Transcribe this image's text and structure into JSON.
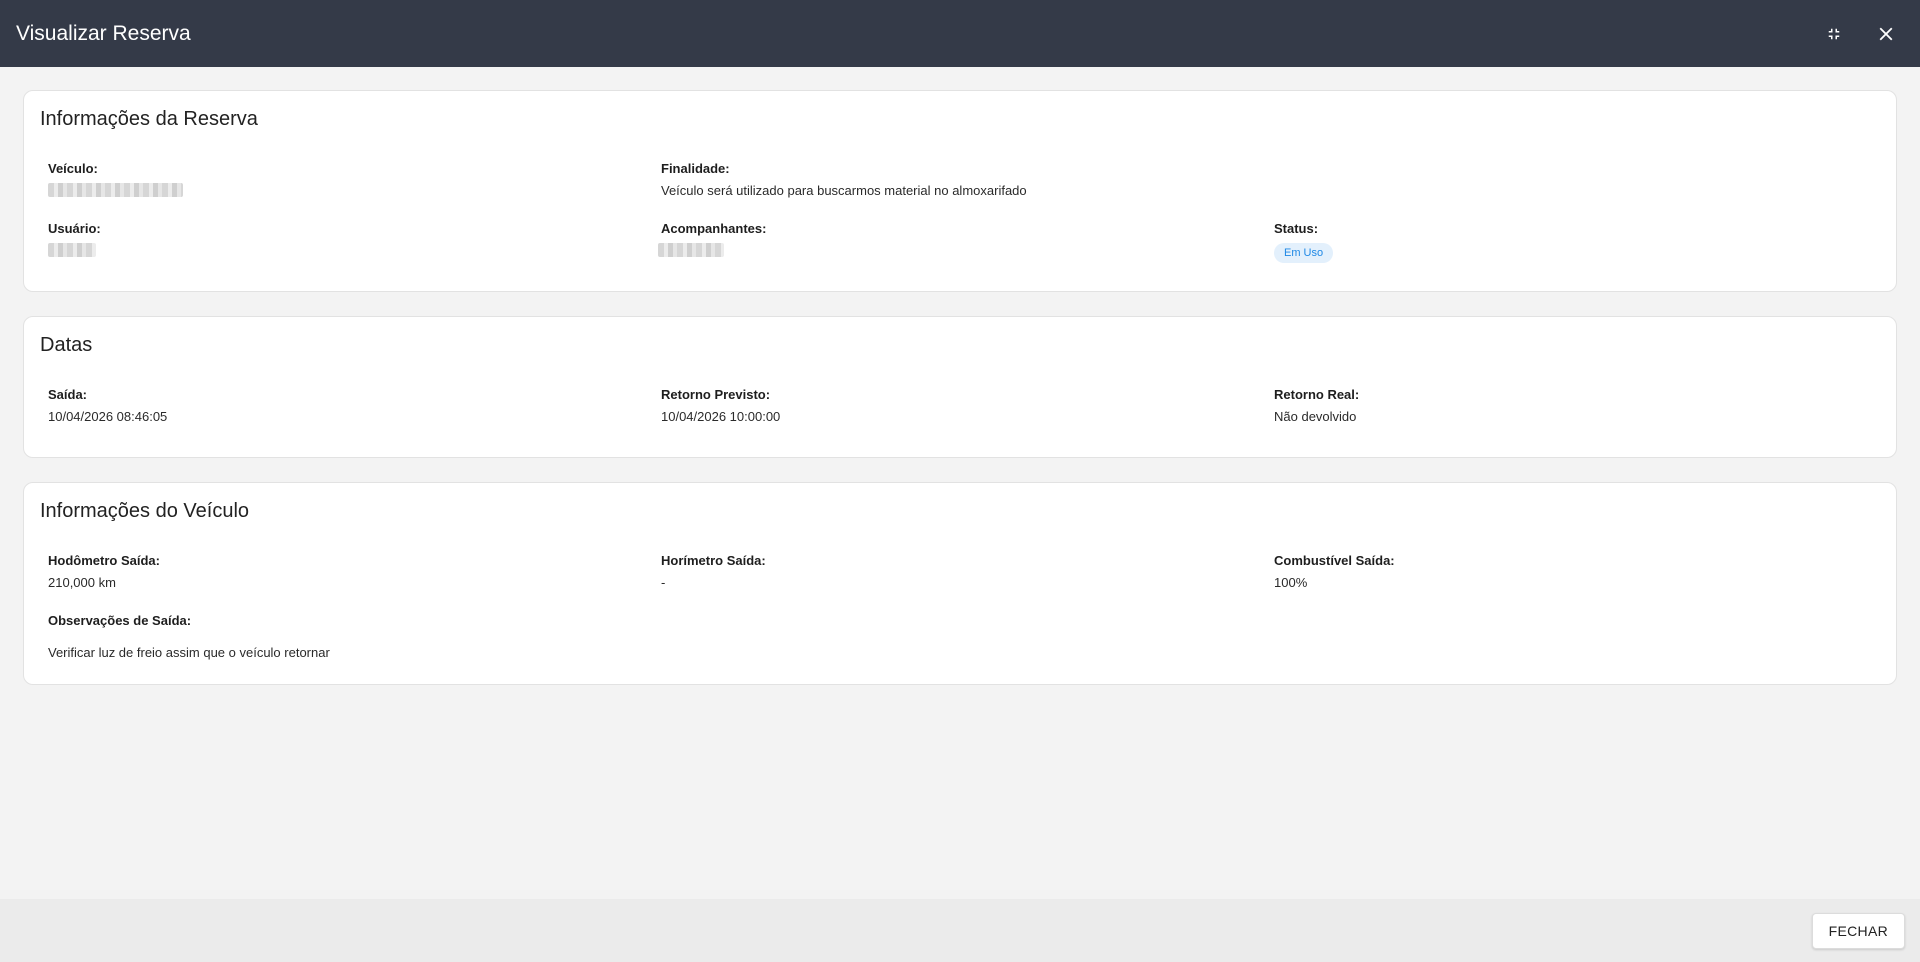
{
  "dialog": {
    "title": "Visualizar Reserva",
    "icons": {
      "minimize": "fullscreen-exit-icon",
      "close": "close-icon"
    }
  },
  "reserva": {
    "title": "Informações da Reserva",
    "veiculo_label": "Veículo:",
    "finalidade_label": "Finalidade:",
    "finalidade_value": "Veículo será utilizado para buscarmos material no almoxarifado",
    "usuario_label": "Usuário:",
    "acompanhantes_label": "Acompanhantes:",
    "status_label": "Status:",
    "status_value": "Em Uso"
  },
  "datas": {
    "title": "Datas",
    "saida_label": "Saída:",
    "saida_value": "10/04/2026 08:46:05",
    "retorno_previsto_label": "Retorno Previsto:",
    "retorno_previsto_value": "10/04/2026 10:00:00",
    "retorno_real_label": "Retorno Real:",
    "retorno_real_value": "Não devolvido"
  },
  "veiculo": {
    "title": "Informações do Veículo",
    "hodometro_label": "Hodômetro Saída:",
    "hodometro_value": "210,000 km",
    "horimetro_label": "Horímetro Saída:",
    "horimetro_value": "-",
    "combustivel_label": "Combustível Saída:",
    "combustivel_value": "100%",
    "observacoes_label": "Observações de Saída:",
    "observacoes_value": "Verificar luz de freio assim que o veículo retornar"
  },
  "footer": {
    "fechar_label": "FECHAR"
  },
  "colors": {
    "titlebar": "#343a48",
    "badge_text": "#1e88e5",
    "badge_bg": "#e3f0fc"
  }
}
